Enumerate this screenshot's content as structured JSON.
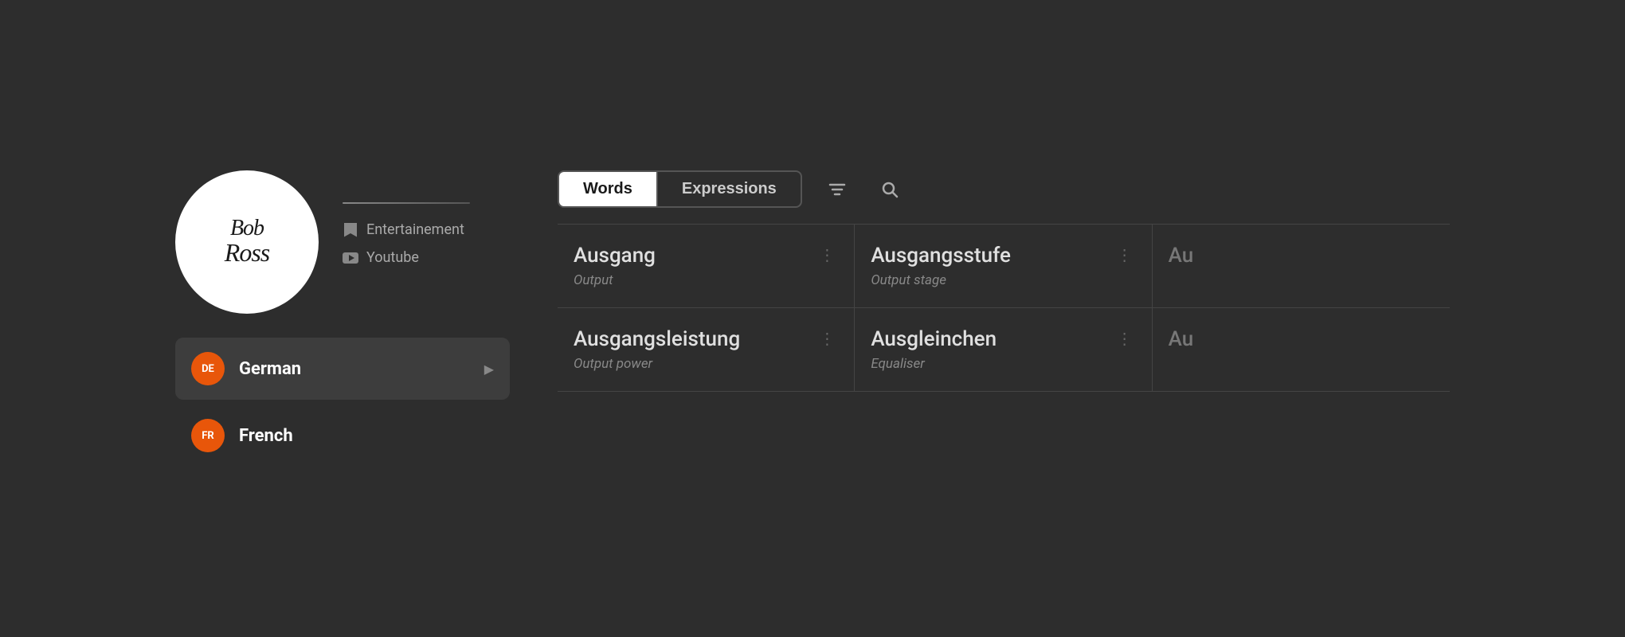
{
  "profile": {
    "logo_text": "Bob Ross",
    "logo_line1": "Bob",
    "logo_line2": "Ross",
    "category": "Entertainement",
    "platform": "Youtube"
  },
  "languages": [
    {
      "code": "DE",
      "name": "German",
      "active": true
    },
    {
      "code": "FR",
      "name": "French",
      "active": false
    }
  ],
  "toolbar": {
    "tab_words_label": "Words",
    "tab_expressions_label": "Expressions",
    "filter_icon_name": "filter-icon",
    "search_icon_name": "search-icon"
  },
  "words": [
    {
      "word": "Ausgang",
      "translation": "Output"
    },
    {
      "word": "Ausgangsstufe",
      "translation": "Output stage"
    },
    {
      "word": "Au",
      "translation": "",
      "truncated": true
    },
    {
      "word": "Ausgangsleistung",
      "translation": "Output power"
    },
    {
      "word": "Ausgleinchen",
      "translation": "Equaliser"
    },
    {
      "word": "Au",
      "translation": "",
      "truncated": true
    }
  ]
}
